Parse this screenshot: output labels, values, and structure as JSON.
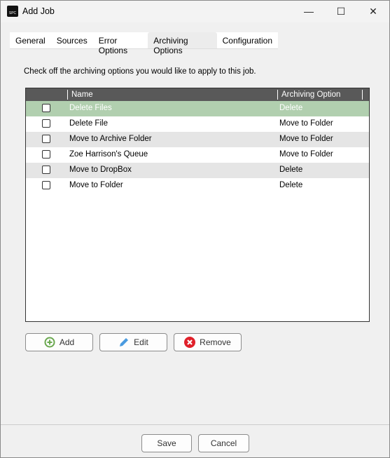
{
  "window": {
    "title": "Add Job",
    "minimize": "—",
    "maximize": "☐",
    "close": "✕"
  },
  "tabs": [
    {
      "label": "General"
    },
    {
      "label": "Sources"
    },
    {
      "label": "Error Options"
    },
    {
      "label": "Archiving Options",
      "active": true
    },
    {
      "label": "Configuration"
    }
  ],
  "instructions": "Check off the archiving options you would like to apply to this job.",
  "grid": {
    "columns": {
      "name": "Name",
      "option": "Archiving Option"
    },
    "rows": [
      {
        "name": "Delete Files",
        "option": "Delete",
        "checked": false,
        "selected": true
      },
      {
        "name": "Delete File",
        "option": "Move to Folder",
        "checked": false
      },
      {
        "name": "Move to Archive Folder",
        "option": "Move to Folder",
        "checked": false
      },
      {
        "name": "Zoe Harrison's Queue",
        "option": "Move to Folder",
        "checked": false
      },
      {
        "name": "Move to DropBox",
        "option": "Delete",
        "checked": false
      },
      {
        "name": "Move to Folder",
        "option": "Delete",
        "checked": false
      }
    ]
  },
  "buttons": {
    "add": "Add",
    "edit": "Edit",
    "remove": "Remove",
    "save": "Save",
    "cancel": "Cancel"
  },
  "colors": {
    "selected_row": "#b1cfaf",
    "header": "#595959",
    "add_icon": "#6aa84f",
    "edit_icon": "#4a9be0",
    "remove_icon": "#e0202a"
  }
}
